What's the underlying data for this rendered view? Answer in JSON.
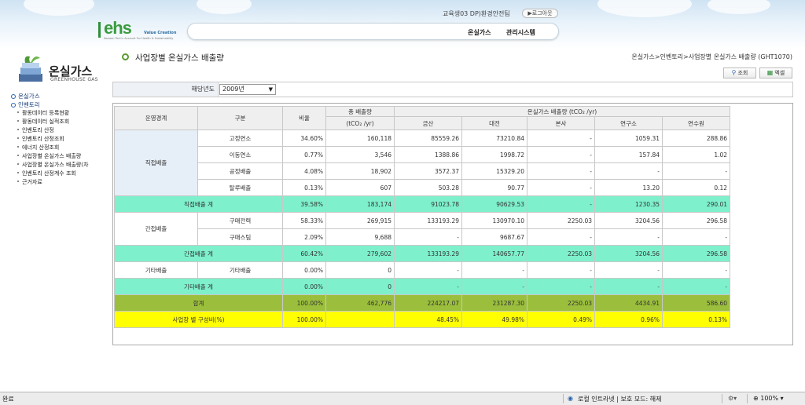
{
  "header": {
    "logo_text": "ehs",
    "logo_tagline": "Value Creation",
    "logo_subtext": "Nanoon Tech's Account For Health & Sustainability",
    "user_name": "교육생03 DP)환경안전팀",
    "logout_label": "▶로그아웃",
    "nav": {
      "greenhouse_label": "온실가스",
      "system_label": "관리시스템"
    }
  },
  "sidebar": {
    "title": "온실가스",
    "subtitle": "GREENHOUSE GAS",
    "menu": [
      {
        "label": "온실가스",
        "level": 1
      },
      {
        "label": "인벤토리",
        "level": 1
      },
      {
        "label": "활동데이터 등록현황",
        "level": 2
      },
      {
        "label": "활동데이터 실적조회",
        "level": 2
      },
      {
        "label": "인벤토리 산정",
        "level": 2
      },
      {
        "label": "인벤토리 산정조회",
        "level": 2
      },
      {
        "label": "에너지 산정조회",
        "level": 2
      },
      {
        "label": "사업장별 온실가스 배출량",
        "level": 2
      },
      {
        "label": "사업장별 온실가스 배출량(차",
        "level": 2
      },
      {
        "label": "인벤토리 산정계수 조회",
        "level": 2
      },
      {
        "label": "근거자료",
        "level": 2
      }
    ]
  },
  "page": {
    "title": "사업장별 온실가스 배출량",
    "breadcrumb": "온실가스>인벤토리>사업장별 온실가스 배출량 (GHT1070)",
    "search_label": "조회",
    "excel_label": "엑셀"
  },
  "filter": {
    "year_label": "해당년도",
    "year_value": "2009년"
  },
  "table": {
    "headers": {
      "category": "운영경계",
      "type": "구분",
      "ratio": "비율",
      "total": "총 배출량",
      "total_unit": "(tCO₂ /yr)",
      "site_group": "온실가스 배출량 (tCO₂ /yr)",
      "sites": [
        "금산",
        "대전",
        "본사",
        "연구소",
        "연수원"
      ]
    },
    "groups": {
      "direct": "직접배출",
      "indirect": "간접배출",
      "other": "기타배출"
    },
    "direct_rows": [
      {
        "type": "고정연소",
        "ratio": "34.60%",
        "total": "160,118",
        "v": [
          "85559.26",
          "73210.84",
          "-",
          "1059.31",
          "288.86"
        ]
      },
      {
        "type": "이동연소",
        "ratio": "0.77%",
        "total": "3,546",
        "v": [
          "1388.86",
          "1998.72",
          "-",
          "157.84",
          "1.02"
        ]
      },
      {
        "type": "공정배출",
        "ratio": "4.08%",
        "total": "18,902",
        "v": [
          "3572.37",
          "15329.20",
          "-",
          "-",
          "-"
        ]
      },
      {
        "type": "탈루배출",
        "ratio": "0.13%",
        "total": "607",
        "v": [
          "503.28",
          "90.77",
          "-",
          "13.20",
          "0.12"
        ]
      }
    ],
    "direct_subtotal": {
      "label": "직접배출 계",
      "ratio": "39.58%",
      "total": "183,174",
      "v": [
        "91023.78",
        "90629.53",
        "-",
        "1230.35",
        "290.01"
      ]
    },
    "indirect_rows": [
      {
        "type": "구매전력",
        "ratio": "58.33%",
        "total": "269,915",
        "v": [
          "133193.29",
          "130970.10",
          "2250.03",
          "3204.56",
          "296.58"
        ]
      },
      {
        "type": "구매스팀",
        "ratio": "2.09%",
        "total": "9,688",
        "v": [
          "-",
          "9687.67",
          "-",
          "-",
          "-"
        ]
      }
    ],
    "indirect_subtotal": {
      "label": "간접배출 계",
      "ratio": "60.42%",
      "total": "279,602",
      "v": [
        "133193.29",
        "140657.77",
        "2250.03",
        "3204.56",
        "296.58"
      ]
    },
    "other_rows": [
      {
        "type": "기타배출",
        "ratio": "0.00%",
        "total": "0",
        "v": [
          "-",
          "-",
          "-",
          "-",
          "-"
        ]
      }
    ],
    "other_subtotal": {
      "label": "기타배출 계",
      "ratio": "0.00%",
      "total": "0",
      "v": [
        "-",
        "-",
        "-",
        "-",
        "-"
      ]
    },
    "grand_total": {
      "label": "합계",
      "ratio": "100.00%",
      "total": "462,776",
      "v": [
        "224217.07",
        "231287.30",
        "2250.03",
        "4434.91",
        "586.60"
      ]
    },
    "site_ratio": {
      "label": "사업장 별 구성비(%)",
      "ratio": "100.00%",
      "total": "",
      "v": [
        "48.45%",
        "49.98%",
        "0.49%",
        "0.96%",
        "0.13%"
      ]
    }
  },
  "statusbar": {
    "status": "완료",
    "zone": "로컬 인트라넷 | 보호 모드: 해제",
    "zoom": "100%"
  }
}
